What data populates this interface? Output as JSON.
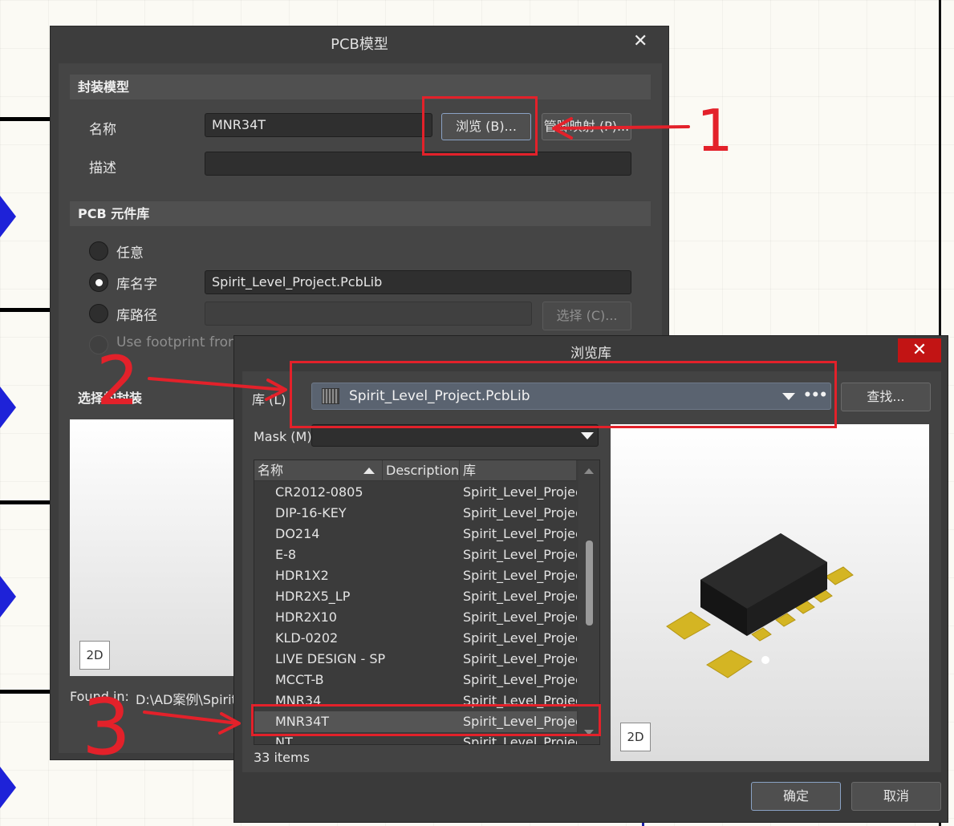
{
  "pcb_dialog": {
    "title": "PCB模型",
    "footprint_section": "封装模型",
    "name_label": "名称",
    "name_value": "MNR34T",
    "desc_label": "描述",
    "desc_value": "",
    "browse_btn": "浏览 (B)...",
    "pinmap_btn": "管脚映射 (P)...",
    "library_section": "PCB 元件库",
    "radio_any": "任意",
    "radio_libname": "库名字",
    "libname_value": "Spirit_Level_Project.PcbLib",
    "radio_libpath": "库路径",
    "select_btn": "选择 (C)...",
    "radio_usefp": "Use footprint from",
    "selected_section": "选择的封装",
    "badge": "2D",
    "found_in_label": "Found in:",
    "found_in_value": "D:\\AD案例\\Spirit"
  },
  "browse_dialog": {
    "title": "浏览库",
    "lib_label": "库 (L)",
    "lib_value": "Spirit_Level_Project.PcbLib",
    "more": "•••",
    "find_btn": "查找...",
    "mask_label": "Mask (M)",
    "mask_value": "",
    "columns": [
      "名称",
      "Description",
      "库"
    ],
    "rows": [
      {
        "name": "CR2012-0805",
        "lib": "Spirit_Level_Project"
      },
      {
        "name": "DIP-16-KEY",
        "lib": "Spirit_Level_Project"
      },
      {
        "name": "DO214",
        "lib": "Spirit_Level_Project"
      },
      {
        "name": "E-8",
        "lib": "Spirit_Level_Project"
      },
      {
        "name": "HDR1X2",
        "lib": "Spirit_Level_Project"
      },
      {
        "name": "HDR2X5_LP",
        "lib": "Spirit_Level_Project"
      },
      {
        "name": "HDR2X10",
        "lib": "Spirit_Level_Project"
      },
      {
        "name": "KLD-0202",
        "lib": "Spirit_Level_Project"
      },
      {
        "name": "LIVE DESIGN - SP",
        "lib": "Spirit_Level_Project"
      },
      {
        "name": "MCCT-B",
        "lib": "Spirit_Level_Project"
      },
      {
        "name": "MNR34",
        "lib": "Spirit_Level_Project"
      },
      {
        "name": "MNR34T",
        "lib": "Spirit_Level_Project"
      },
      {
        "name": "NT",
        "lib": "Spirit_Level_Project"
      }
    ],
    "count": "33 items",
    "badge": "2D",
    "ok_btn": "确定",
    "cancel_btn": "取消"
  },
  "annotations": {
    "mark1": "1",
    "mark2": "2",
    "mark3": "3"
  },
  "colors": {
    "dialog_bg": "#3d3d3d",
    "annotation_red": "#e3212a",
    "close_red": "#c21414",
    "schematic_pin": "#1e22d8",
    "pad_gold": "#d4b523"
  }
}
